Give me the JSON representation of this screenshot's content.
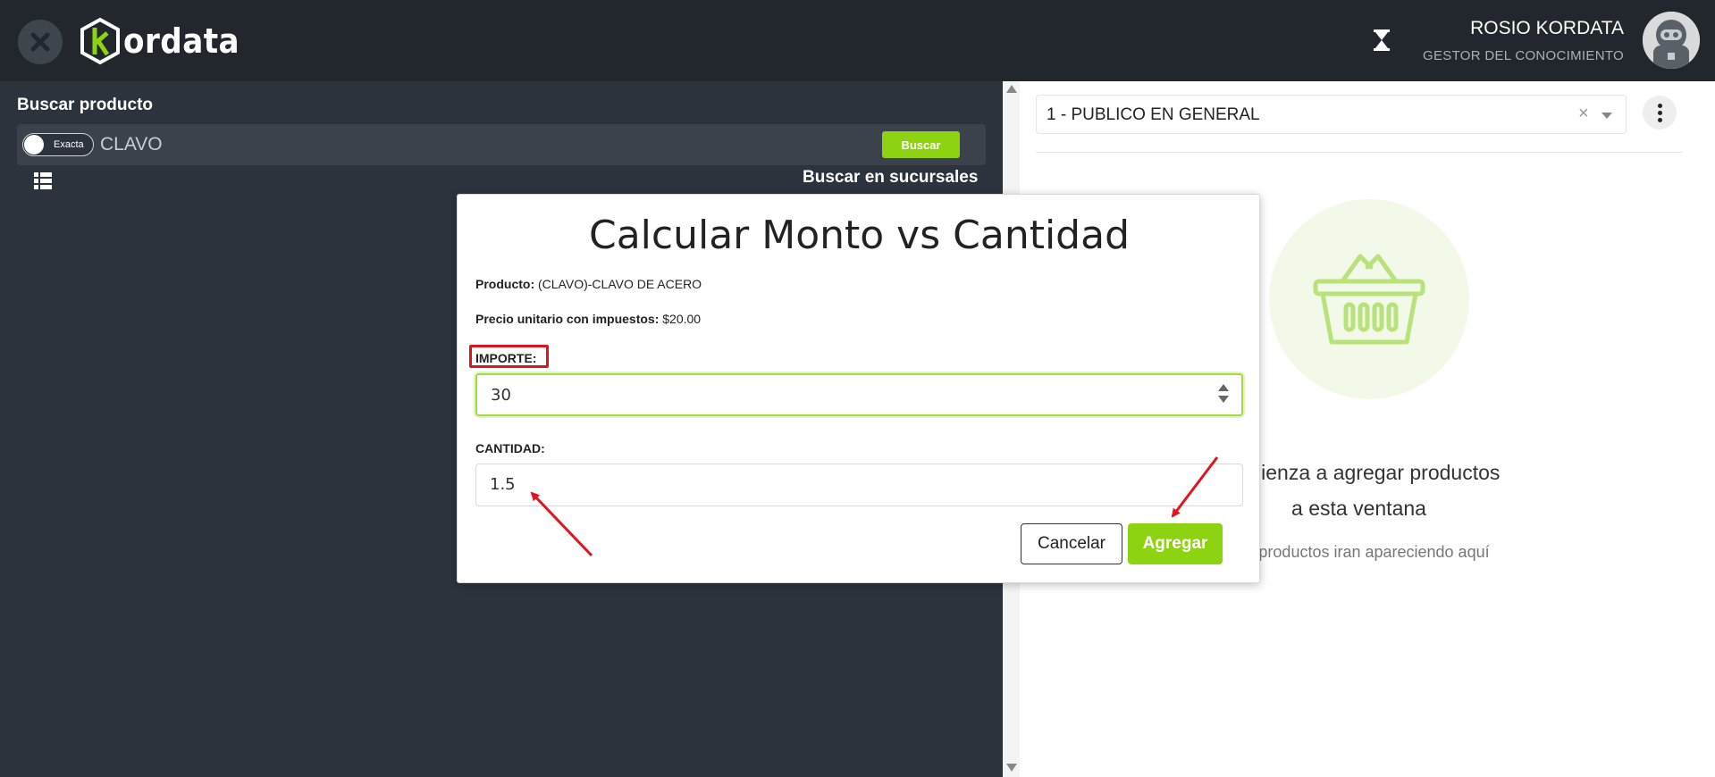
{
  "topbar": {
    "logo_text": "ordata",
    "user_name": "ROSIO KORDATA",
    "user_role": "GESTOR DEL CONOCIMIENTO"
  },
  "search": {
    "title": "Buscar producto",
    "toggle_label": "Exacta",
    "query": "CLAVO",
    "button_label": "Buscar",
    "branches_link": "Buscar en sucursales"
  },
  "cart": {
    "client": "1 - PUBLICO EN GENERAL",
    "clear_symbol": "×",
    "empty_title_line1": "Comienza a agregar productos",
    "empty_title_line2": "a esta ventana",
    "empty_subtitle": "Los productos iran apareciendo aquí"
  },
  "modal": {
    "title": "Calcular Monto vs Cantidad",
    "product_label": "Producto:",
    "product_value": "(CLAVO)-CLAVO DE ACERO",
    "price_label": "Precio unitario con impuestos:",
    "price_value": "$20.00",
    "importe_label": "IMPORTE:",
    "importe_value": "30",
    "cantidad_label": "CANTIDAD:",
    "cantidad_value": "1.5",
    "cancel_label": "Cancelar",
    "add_label": "Agregar"
  },
  "colors": {
    "accent_green": "#8ed312",
    "highlight_red": "#e0141e",
    "topbar_bg": "#22272e",
    "panel_bg": "#2c333c"
  },
  "icons": {
    "close": "close-icon",
    "logo": "kordata-hex-logo",
    "hourglass": "hourglass-icon",
    "avatar": "robot-avatar",
    "list": "list-view-icon",
    "more": "more-vertical-icon",
    "basket": "basket-icon"
  }
}
